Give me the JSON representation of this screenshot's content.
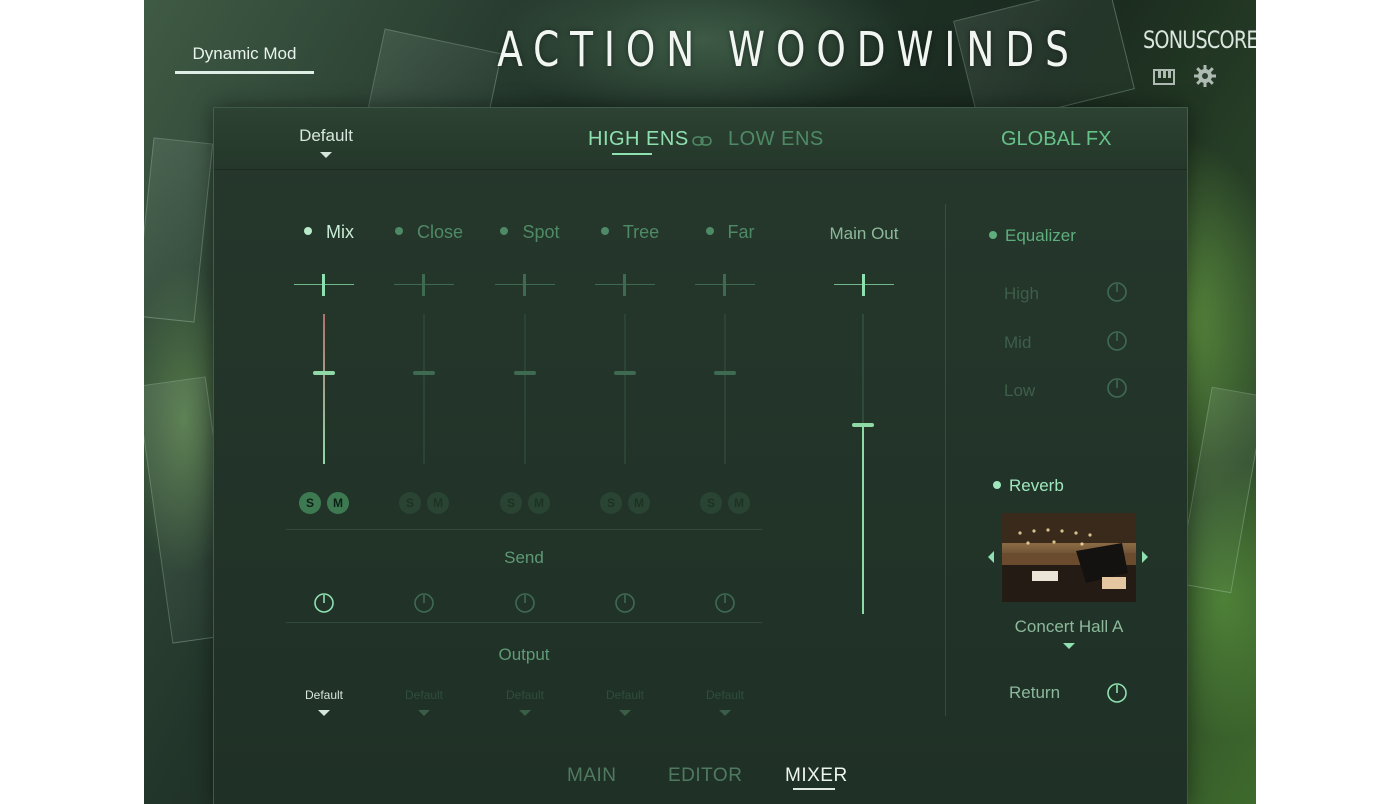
{
  "header": {
    "mode_tab": "Dynamic Mod",
    "product_title": "ACTION WOODWINDS",
    "brand": "SONUSCORE"
  },
  "icons": {
    "piano": "piano-icon",
    "settings": "gear-icon",
    "link": "link-icon",
    "prev": "chevron-left-icon",
    "next": "chevron-right-icon"
  },
  "panel": {
    "preset": "Default",
    "ensemble_tabs": [
      {
        "label": "HIGH ENS",
        "active": true
      },
      {
        "label": "LOW ENS",
        "active": false
      }
    ],
    "global_fx": "GLOBAL FX"
  },
  "mixer": {
    "channels": [
      {
        "name": "Mix",
        "active": true,
        "level": 0.62,
        "solo": "S",
        "mute": "M",
        "output": "Default"
      },
      {
        "name": "Close",
        "active": false,
        "level": 0.62,
        "solo": "S",
        "mute": "M",
        "output": "Default"
      },
      {
        "name": "Spot",
        "active": false,
        "level": 0.62,
        "solo": "S",
        "mute": "M",
        "output": "Default"
      },
      {
        "name": "Tree",
        "active": false,
        "level": 0.62,
        "solo": "S",
        "mute": "M",
        "output": "Default"
      },
      {
        "name": "Far",
        "active": false,
        "level": 0.62,
        "solo": "S",
        "mute": "M",
        "output": "Default"
      }
    ],
    "send_label": "Send",
    "output_label": "Output",
    "main_out_label": "Main Out",
    "main_out_level": 0.63
  },
  "global_fx": {
    "equalizer": {
      "title": "Equalizer",
      "bands": [
        "High",
        "Mid",
        "Low"
      ]
    },
    "reverb": {
      "title": "Reverb",
      "preset": "Concert Hall A",
      "return_label": "Return"
    }
  },
  "bottom_tabs": [
    {
      "label": "MAIN",
      "active": false
    },
    {
      "label": "EDITOR",
      "active": false
    },
    {
      "label": "MIXER",
      "active": true
    }
  ],
  "colors": {
    "accent": "#8fe0b0",
    "accent_dim": "#4f8a66",
    "panel_bg": "#22352a"
  }
}
